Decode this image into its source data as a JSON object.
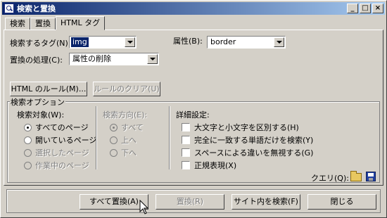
{
  "window": {
    "title": "検索と置換",
    "controls": [
      "_",
      "□",
      "×"
    ]
  },
  "tabs": [
    {
      "label": "検索"
    },
    {
      "label": "置換"
    },
    {
      "label": "HTML タグ",
      "active": true
    }
  ],
  "form": {
    "search_tag_label": "検索するタグ(N):",
    "search_tag_value": "img",
    "process_label": "置換の処理(C):",
    "process_value": "属性の削除",
    "attribute_label": "属性(B):",
    "attribute_value": "border"
  },
  "buttons": {
    "html_rules": "HTML のルール(M)...",
    "clear_rules": "ルールのクリア(U)"
  },
  "search_options": {
    "title": "検索オプション",
    "target": {
      "title": "検索対象(W):",
      "options": [
        {
          "label": "すべてのページ",
          "checked": true,
          "enabled": true
        },
        {
          "label": "開いているページ",
          "checked": false,
          "enabled": true
        },
        {
          "label": "選択したページ",
          "checked": false,
          "enabled": false
        },
        {
          "label": "作業中のページ",
          "checked": false,
          "enabled": false
        }
      ]
    },
    "direction": {
      "title": "検索方向(E):",
      "options": [
        {
          "label": "すべて",
          "checked": true
        },
        {
          "label": "上へ",
          "checked": false
        },
        {
          "label": "下へ",
          "checked": false
        }
      ]
    },
    "advanced": {
      "title": "詳細設定:",
      "checkboxes": [
        {
          "label": "大文字と小文字を区別する(H)",
          "checked": false
        },
        {
          "label": "完全に一致する単語だけを検索(Y)",
          "checked": false
        },
        {
          "label": "スペースによる違いを無視する(G)",
          "checked": false
        },
        {
          "label": "正規表現(X)",
          "checked": false
        }
      ]
    },
    "query_label": "クエリ(Q):"
  },
  "footer": {
    "replace_all": "すべて置換(A)",
    "replace": "置換(R)",
    "find_in_site": "サイト内を検索(F)",
    "close": "閉じる"
  }
}
